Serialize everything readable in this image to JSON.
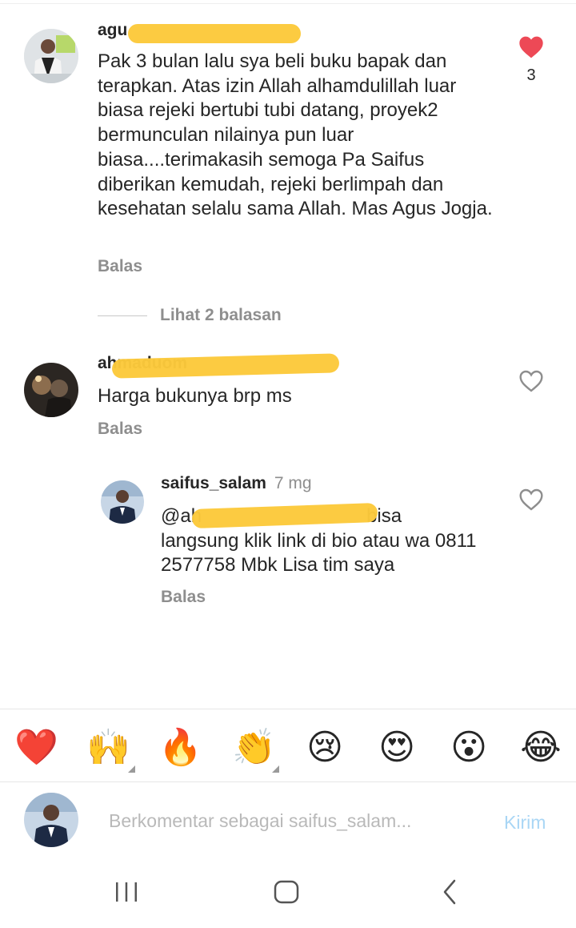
{
  "comments": [
    {
      "username": "agu",
      "text": "Pak 3 bulan lalu sya beli buku bapak dan terapkan. Atas izin Allah alhamdulillah luar biasa rejeki bertubi tubi datang, proyek2 bermunculan nilainya pun luar biasa....terimakasih semoga Pa Saifus diberikan kemudah, rejeki berlimpah dan kesehatan selalu sama Allah. Mas Agus Jogja.",
      "reply_label": "Balas",
      "likes": "3",
      "liked": true
    },
    {
      "username": "ahmaduom",
      "text": "Harga bukunya brp ms",
      "reply_label": "Balas",
      "liked": false
    }
  ],
  "view_replies_label": "Lihat 2 balasan",
  "reply": {
    "username": "saifus_salam",
    "time": "7 mg",
    "mention": "@ah",
    "text_line1_tail": "bisa",
    "text_rest": "langsung klik link di bio atau wa 0811 2577758 Mbk Lisa tim saya",
    "reply_label": "Balas",
    "liked": false
  },
  "emoji_bar": [
    {
      "name": "heart-emoji",
      "glyph": "❤️"
    },
    {
      "name": "raised-hands-emoji",
      "glyph": "🙌"
    },
    {
      "name": "fire-emoji",
      "glyph": "🔥"
    },
    {
      "name": "clapping-hands-emoji",
      "glyph": "👏"
    },
    {
      "name": "crying-face-emoji",
      "glyph": "😢"
    },
    {
      "name": "heart-eyes-emoji",
      "glyph": "😍"
    },
    {
      "name": "surprised-face-emoji",
      "glyph": "😮"
    },
    {
      "name": "tears-of-joy-emoji",
      "glyph": "😂"
    }
  ],
  "composer": {
    "placeholder": "Berkomentar sebagai saifus_salam...",
    "send_label": "Kirim"
  },
  "colors": {
    "like_red": "#ed4956",
    "secondary_text": "#8e8e8e",
    "send_disabled": "#a9d6f5",
    "redaction": "#fcc93b"
  }
}
